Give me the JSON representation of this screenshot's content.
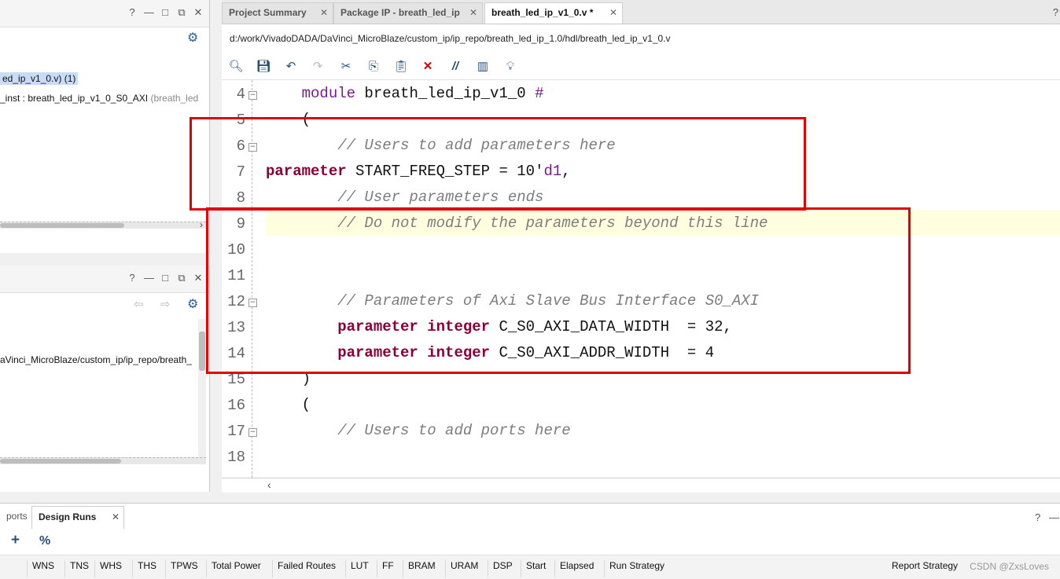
{
  "top_left_panel": {
    "controls": [
      "?",
      "—",
      "□",
      "⧉",
      "✕"
    ],
    "tree_items": [
      {
        "text": "ed_ip_v1_0.v) (1)"
      },
      {
        "text": "_inst : breath_led_ip_v1_0_S0_AXI",
        "suffix": "(breath_led"
      }
    ]
  },
  "mid_left_panel": {
    "controls": [
      "?",
      "—",
      "□",
      "⧉",
      "✕"
    ],
    "path_text": "aVinci_MicroBlaze/custom_ip/ip_repo/breath_"
  },
  "tabs": [
    {
      "label": "Project Summary",
      "active": false
    },
    {
      "label": "Package IP - breath_led_ip",
      "active": false
    },
    {
      "label": "breath_led_ip_v1_0.v *",
      "active": true
    }
  ],
  "tab_help": "?",
  "file_path": "d:/work/VivadoDADA/DaVinci_MicroBlaze/custom_ip/ip_repo/breath_led_ip_1.0/hdl/breath_led_ip_v1_0.v",
  "editor": {
    "lines": [
      {
        "n": "4",
        "fold": true,
        "parts": [
          [
            "    ",
            ""
          ],
          [
            "module",
            "mod"
          ],
          [
            " breath_led_ip_v1_0 ",
            ""
          ],
          [
            "#",
            "mod"
          ]
        ]
      },
      {
        "n": "5",
        "fold": false,
        "parts": [
          [
            "    (",
            ""
          ]
        ]
      },
      {
        "n": "6",
        "fold": true,
        "parts": [
          [
            "        ",
            ""
          ],
          [
            "// Users to add parameters here",
            "cm"
          ]
        ]
      },
      {
        "n": "7",
        "fold": false,
        "parts": [
          [
            "parameter",
            "kw"
          ],
          [
            " START_FREQ_STEP = 10'",
            ""
          ],
          [
            "d",
            "num-d"
          ],
          [
            "1",
            "num-d"
          ],
          [
            ",",
            ""
          ]
        ]
      },
      {
        "n": "8",
        "fold": false,
        "parts": [
          [
            "        ",
            ""
          ],
          [
            "// User parameters ends",
            "cm"
          ]
        ]
      },
      {
        "n": "9",
        "fold": false,
        "parts": [
          [
            "        ",
            ""
          ],
          [
            "// Do not modify the parameters beyond this line",
            "cm"
          ]
        ]
      },
      {
        "n": "10",
        "fold": false,
        "parts": [
          [
            "",
            ""
          ]
        ]
      },
      {
        "n": "11",
        "fold": false,
        "parts": [
          [
            "",
            ""
          ]
        ]
      },
      {
        "n": "12",
        "fold": true,
        "parts": [
          [
            "        ",
            ""
          ],
          [
            "// Parameters of Axi Slave Bus Interface S0_AXI",
            "cm"
          ]
        ]
      },
      {
        "n": "13",
        "fold": false,
        "parts": [
          [
            "        ",
            ""
          ],
          [
            "parameter",
            "kw"
          ],
          [
            " ",
            ""
          ],
          [
            "integer",
            "kw"
          ],
          [
            " C_S0_AXI_DATA_WIDTH  = 32,",
            ""
          ]
        ]
      },
      {
        "n": "14",
        "fold": false,
        "parts": [
          [
            "        ",
            ""
          ],
          [
            "parameter",
            "kw"
          ],
          [
            " ",
            ""
          ],
          [
            "integer",
            "kw"
          ],
          [
            " C_S0_AXI_ADDR_WIDTH  = 4",
            ""
          ]
        ]
      },
      {
        "n": "15",
        "fold": false,
        "parts": [
          [
            "    )",
            ""
          ]
        ]
      },
      {
        "n": "16",
        "fold": false,
        "parts": [
          [
            "    (",
            ""
          ]
        ]
      },
      {
        "n": "17",
        "fold": true,
        "parts": [
          [
            "        ",
            ""
          ],
          [
            "// Users to add ports here",
            "cm"
          ]
        ]
      },
      {
        "n": "18",
        "fold": false,
        "parts": [
          [
            "",
            ""
          ]
        ]
      }
    ]
  },
  "bottom": {
    "tabs": [
      "ports",
      "Design Runs"
    ],
    "help": "?",
    "columns": [
      "WNS",
      "TNS",
      "WHS",
      "THS",
      "TPWS",
      "Total Power",
      "Failed Routes",
      "LUT",
      "FF",
      "BRAM",
      "URAM",
      "DSP",
      "Start",
      "Elapsed",
      "Run Strategy"
    ],
    "right_column": "Report Strategy",
    "add_label": "+",
    "percent_label": "%"
  },
  "watermark": "CSDN @ZxsLoves"
}
